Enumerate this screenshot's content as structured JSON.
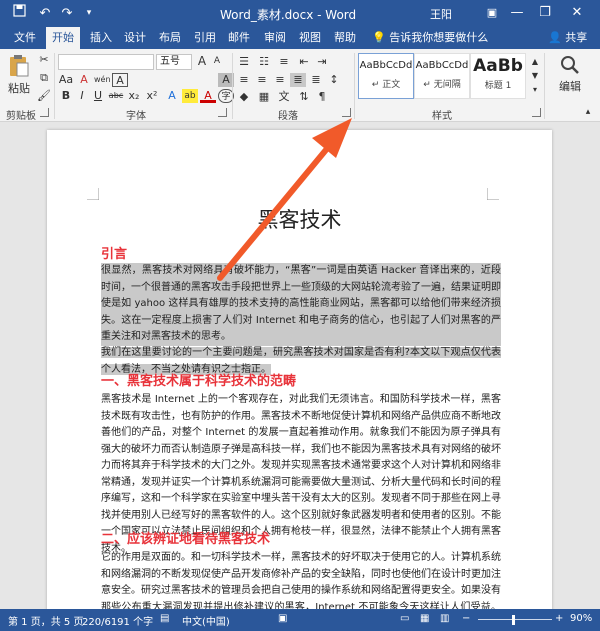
{
  "titlebar": {
    "save_icon": "save-icon",
    "undo_icon": "undo-icon",
    "redo_icon": "redo-icon",
    "customize_icon": "chevron-down-icon",
    "title": "Word_素材.docx  -  Word",
    "user": "王阳",
    "minimize": "—",
    "restore": "❐",
    "close": "✕",
    "ribbon_display": "▣"
  },
  "tabs": [
    "文件",
    "开始",
    "插入",
    "设计",
    "布局",
    "引用",
    "邮件",
    "审阅",
    "视图",
    "帮助"
  ],
  "active_tab": "开始",
  "tellme": "告诉我你想要做什么",
  "share": "共享",
  "ribbon": {
    "clipboard": {
      "label": "剪贴板",
      "paste": "粘贴"
    },
    "font": {
      "label": "字体",
      "font_name": "",
      "font_size": "五号",
      "grow": "A",
      "shrink": "A",
      "aa": "Aa",
      "clear": "A",
      "wen": "wén",
      "border_char": "A",
      "bold": "B",
      "italic": "I",
      "underline": "U",
      "strike": "abc",
      "sub": "x₂",
      "sup": "x²",
      "effects": "A",
      "highlight": "ab",
      "color": "A",
      "shade": "A",
      "circle": "字"
    },
    "paragraph": {
      "label": "段落"
    },
    "styles": {
      "label": "样式",
      "items": [
        {
          "sample": "AaBbCcDd",
          "name": "↵ 正文"
        },
        {
          "sample": "AaBbCcDd",
          "name": "↵ 无间隔"
        },
        {
          "sample": "AaBb",
          "name": "标题 1"
        }
      ]
    },
    "editing": {
      "label": "编辑"
    }
  },
  "document": {
    "title": "黑客技术",
    "sections": [
      {
        "heading": "引言",
        "paragraphs": [
          "很显然，黑客技术对网络具有破坏能力，“黑客”一词是由英语 Hacker 音译出来的，近段时间，一个很普通的黑客攻击手段把世界上一些顶级的大网站轮流考验了一遍，结果证明即使是如 yahoo 这样具有雄厚的技术支持的高性能商业网站，黑客都可以给他们带来经济损失。这在一定程度上损害了人们对 Internet 和电子商务的信心，也引起了人们对黑客的严重关注和对黑客技术的思考。",
          "我们在这里要讨论的一个主要问题是，研究黑客技术对国家是否有利?本文以下观点仅代表个人看法，不当之处请有识之士指正。"
        ]
      },
      {
        "heading": "一、黑客技术属于科学技术的范畴",
        "paragraphs": [
          "黑客技术是 Internet 上的一个客观存在，对此我们无须讳言。和国防科学技术一样，黑客技术既有攻击性，也有防护的作用。黑客技术不断地促使计算机和网络产品供应商不断地改善他们的产品，对整个 Internet 的发展一直起着推动作用。就象我们不能因为原子弹具有强大的破坏力而否认制造原子弹是高科技一样，我们也不能因为黑客技术具有对网络的破坏力而将其弃于科学技术的大门之外。发现并实现黑客技术通常要求这个人对计算机和网络非常精通，发现并证实一个计算机系统漏洞可能需要做大量测试、分析大量代码和长时间的程序编写，这和一个科学家在实验室中埋头苦干没有太大的区别。发现者不同于那些在网上寻找并使用别人已经写好的黑客软件的人。这个区别就好象武器发明者和使用者的区别。不能一个国家可以立法禁止民间组织和个人拥有枪枝一样，很显然，法律不能禁止个人拥有黑客技术。"
        ]
      },
      {
        "heading": "二、应该辨证地看待黑客技术",
        "paragraphs": [
          "它的作用是双面的。和一切科学技术一样，黑客技术的好坏取决于使用它的人。计算机系统和网络漏洞的不断发现促使产品开发商修补产品的安全缺陷，同时也使他们在设计时更加注意安全。研究过黑客技术的管理员会把自己使用的操作系统和网络配置得更安全。如果没有那些公布重大漏洞发现并提出修补建议的黑客，Internet 不可能象今天这样让人们受益。也不会有今天这么强壮（相对于以前而言）。"
        ]
      }
    ]
  },
  "statusbar": {
    "page": "第 1 页，共 5 页",
    "words": "220/6191 个字",
    "language": "中文(中国)",
    "zoom": "90%"
  },
  "colors": {
    "accent": "#2b579a",
    "heading": "#e8333a",
    "arrow": "#f15a2a",
    "selection": "#c9c9c9"
  }
}
